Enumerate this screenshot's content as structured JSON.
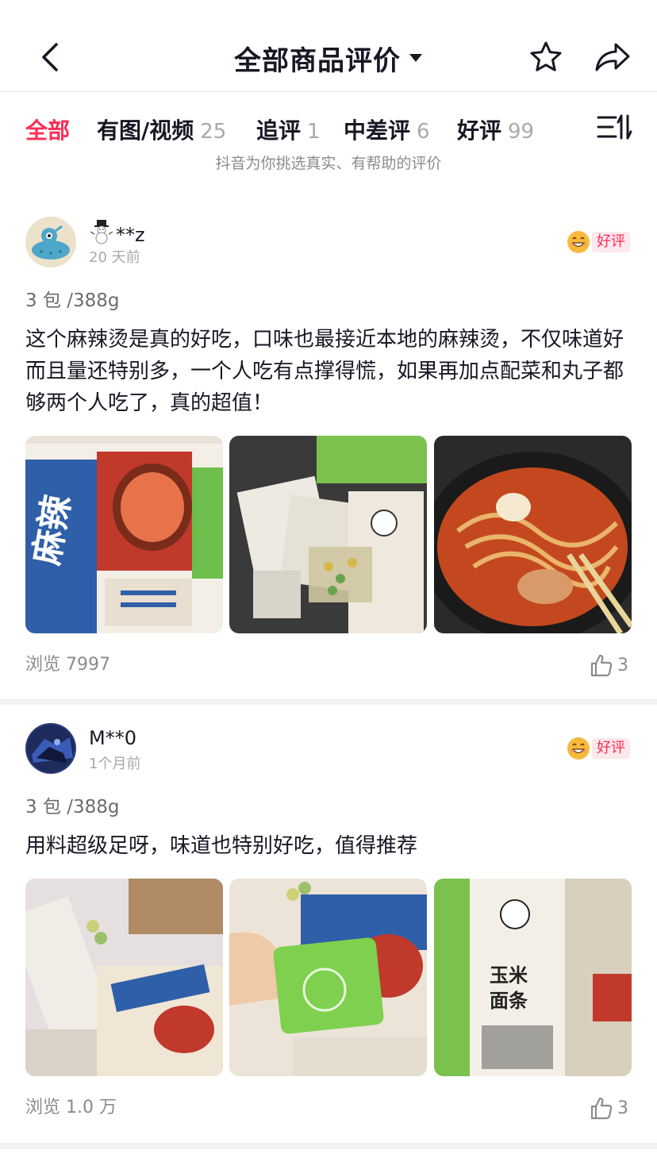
{
  "header": {
    "title": "全部商品评价"
  },
  "tabs": [
    {
      "label": "全部",
      "count": ""
    },
    {
      "label": "有图/视频",
      "count": "25"
    },
    {
      "label": "追评",
      "count": "1"
    },
    {
      "label": "中差评",
      "count": "6"
    },
    {
      "label": "好评",
      "count": "99"
    }
  ],
  "tip": "抖音为你挑选真实、有帮助的评价",
  "reviews": [
    {
      "user": "**z",
      "user_prefix_icon": "snowman-icon",
      "time": "20 天前",
      "badge": "好评",
      "spec": "3 包 /388g",
      "content": "这个麻辣烫是真的好吃，口味也最接近本地的麻辣烫，不仅味道好而且量还特别多，一个人吃有点撑得慌，如果再加点配菜和丸子都够两个人吃了，真的超值！",
      "views": "浏览 7997",
      "likes": "3"
    },
    {
      "user": "M**0",
      "time": "1个月前",
      "badge": "好评",
      "spec": "3 包 /388g",
      "content": "用料超级足呀，味道也特别好吃，值得推荐",
      "views": "浏览 1.0 万",
      "likes": "3"
    }
  ],
  "colors": {
    "accent": "#fe2c55",
    "badge_bg": "#fde8ec",
    "muted": "#a9a9ae"
  }
}
